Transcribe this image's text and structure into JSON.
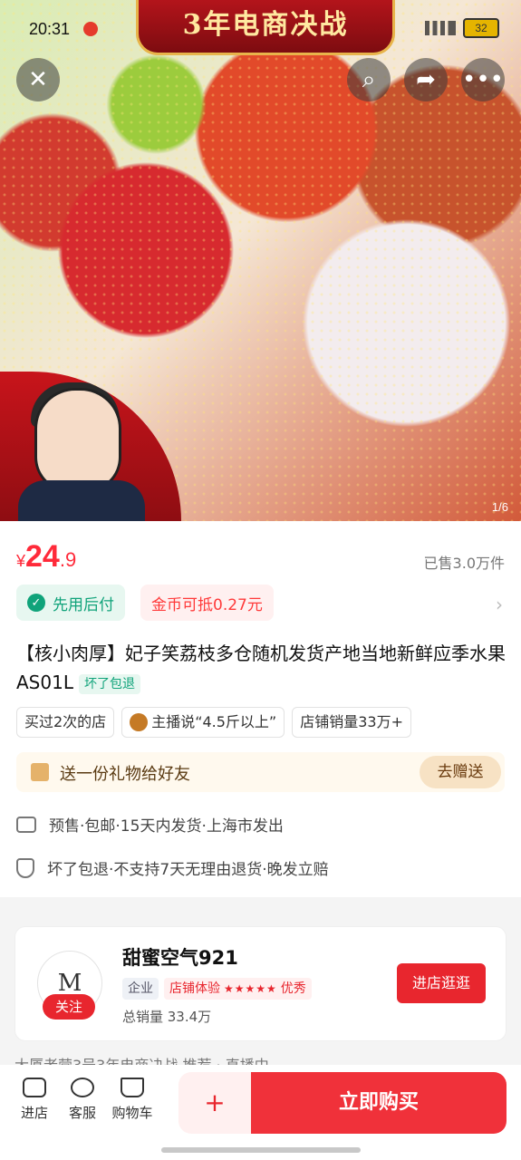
{
  "status": {
    "time": "20:31",
    "battery": "32",
    "network": "5G 4G"
  },
  "banner": {
    "text": "3年电商决战"
  },
  "gallery": {
    "counter": "1/6"
  },
  "product": {
    "price_symbol": "¥",
    "price_int": "24",
    "price_dec": ".9",
    "sold": "已售3.0万件",
    "pay_later": "先用后付",
    "coin_deduct": "金币可抵0.27元",
    "title": "【核小肉厚】妃子笑荔枝多仓随机发货产地当地新鲜应季水果AS01L",
    "title_tag": "坏了包退",
    "pills": [
      "买过2次的店",
      "主播说“4.5斤以上”",
      "店铺销量33万+"
    ],
    "gift_text": "送一份礼物给好友",
    "gift_button": "去赠送",
    "shipping": "预售·包邮·15天内发货·上海市发出",
    "guarantee": "坏了包退·不支持7天无理由退货·晚发立赔"
  },
  "shop": {
    "name": "甜蜜空气921",
    "logo_text": "M",
    "follow": "关注",
    "badge_type": "企业",
    "badge_exp": "店铺体验",
    "badge_exp_level": "优秀",
    "stars": "★★★★★",
    "sales": "总销量 33.4万",
    "enter_button": "进店逛逛"
  },
  "bottom_nav": {
    "store": "进店",
    "service": "客服",
    "cart": "购物车",
    "add_cart_icon": "+",
    "buy_now": "立即购买"
  },
  "peek_text": "大厦老营3号3年电商决战 推荐 · 直播中"
}
